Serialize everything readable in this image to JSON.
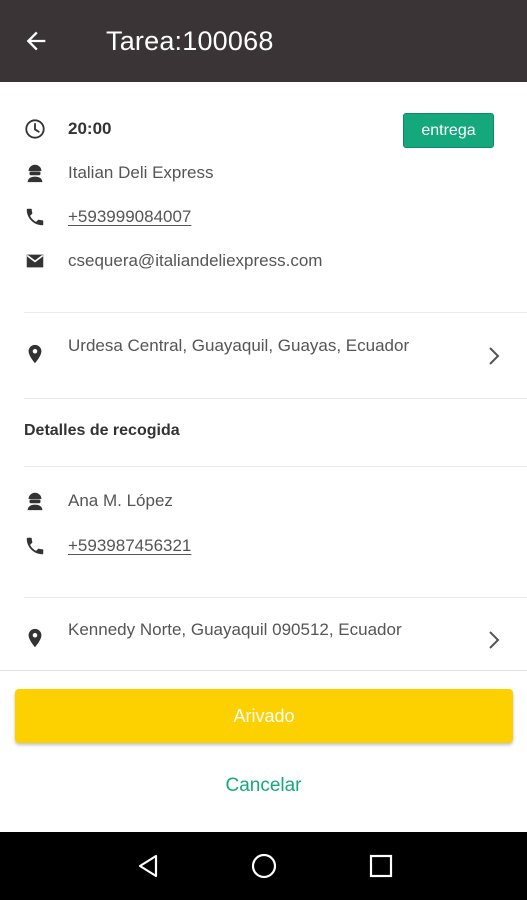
{
  "app_bar": {
    "title": "Tarea:100068",
    "back_icon": "arrow-back-icon"
  },
  "task": {
    "time": "20:00",
    "type_badge": "entrega",
    "customer_name": "Italian Deli Express",
    "phone": "+593999084007",
    "email": "csequera@italiandeliexpress.com",
    "address": "Urdesa Central, Guayaquil, Guayas, Ecuador"
  },
  "pickup": {
    "section_title": "Detalles de recogida",
    "name": "Ana M. López",
    "phone": "+593987456321",
    "address": "Kennedy Norte, Guayaquil 090512, Ecuador"
  },
  "actions": {
    "primary_label": "Arivado",
    "cancel_label": "Cancelar"
  },
  "colors": {
    "app_bar": "#3a3436",
    "accent_green": "#16a87d",
    "primary_yellow": "#fdd000"
  },
  "icons": {
    "time": "clock-icon",
    "person": "person-icon",
    "phone": "phone-icon",
    "email": "mail-icon",
    "location": "location-pin-icon",
    "chevron": "chevron-right-icon",
    "nav_back": "nav-back-icon",
    "nav_home": "nav-home-icon",
    "nav_recents": "nav-recents-icon"
  }
}
